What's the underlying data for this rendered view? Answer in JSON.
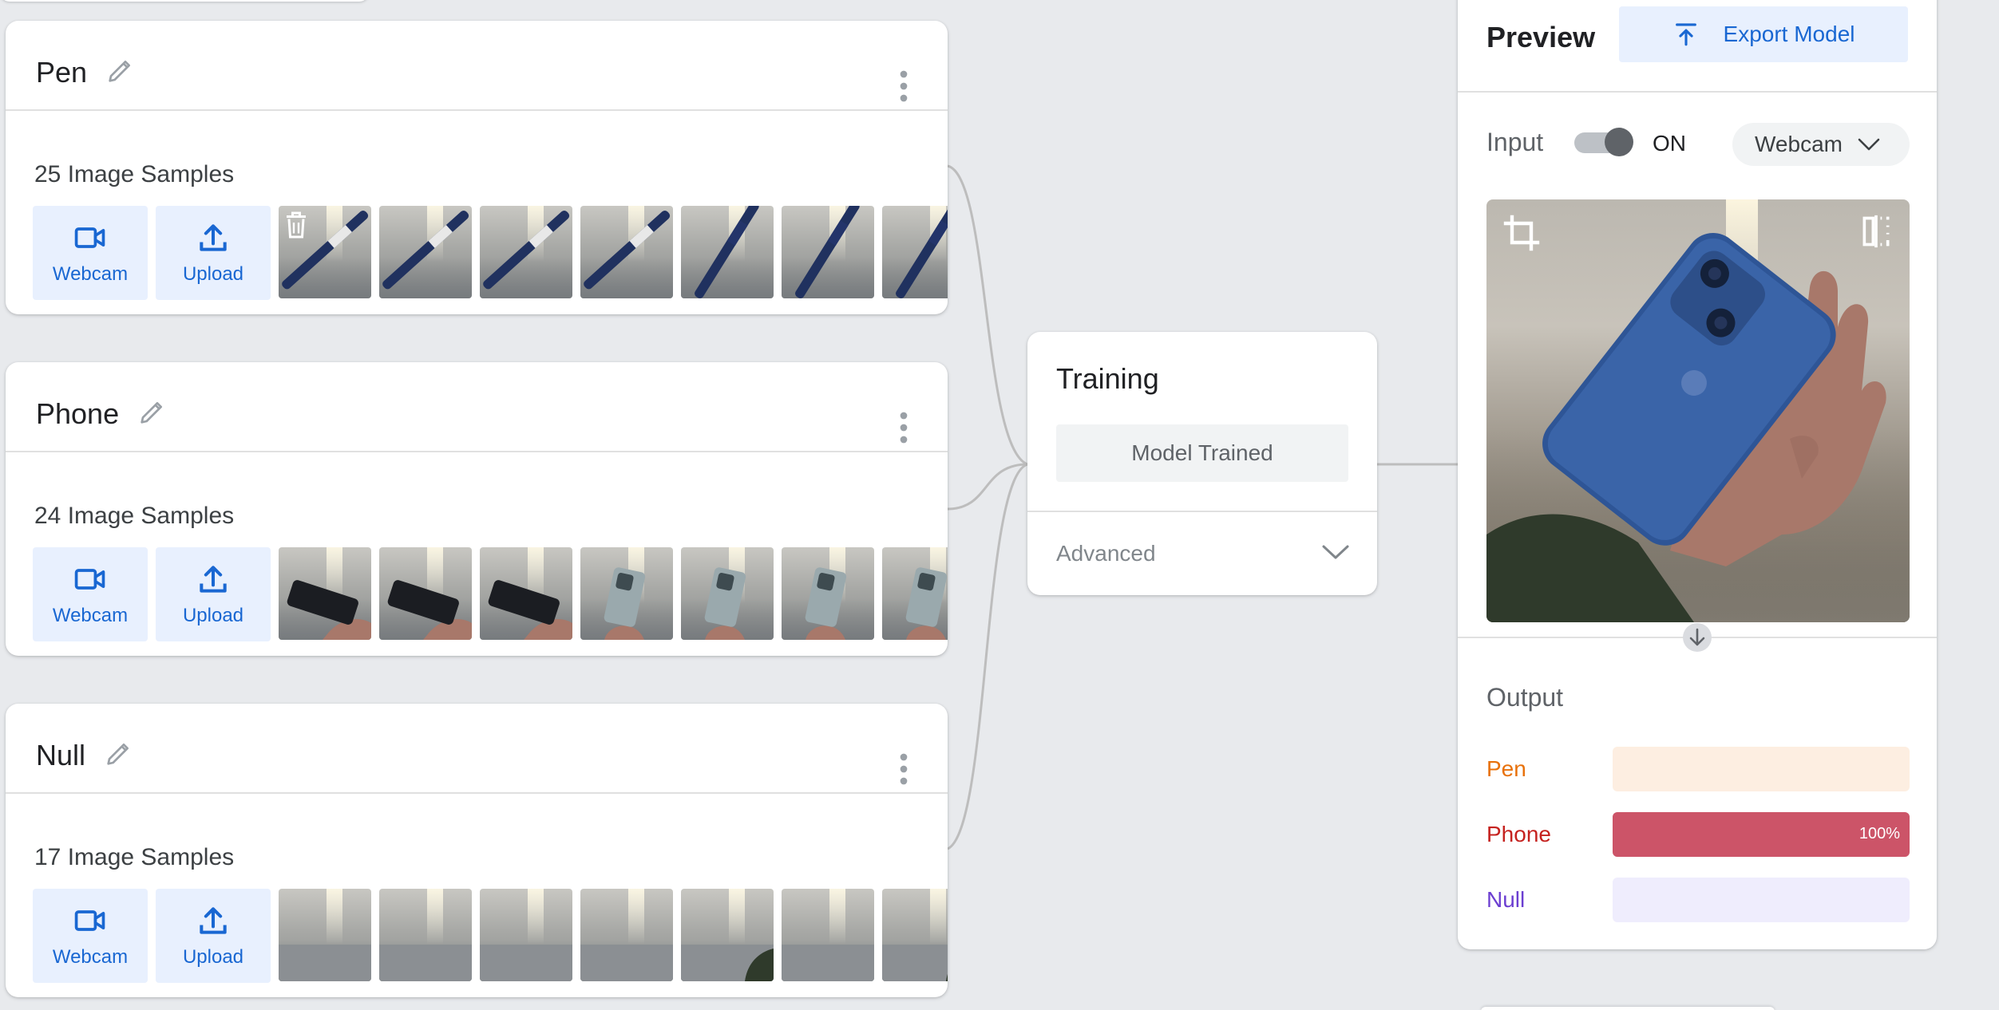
{
  "classes": [
    {
      "name": "Pen",
      "samples_label": "25 Image Samples",
      "thumb_kind": "pen"
    },
    {
      "name": "Phone",
      "samples_label": "24 Image Samples",
      "thumb_kind": "phone"
    },
    {
      "name": "Null",
      "samples_label": "17 Image Samples",
      "thumb_kind": "null"
    }
  ],
  "sample_buttons": {
    "webcam": "Webcam",
    "upload": "Upload"
  },
  "training": {
    "title": "Training",
    "status_button": "Model Trained",
    "advanced_label": "Advanced"
  },
  "preview": {
    "title": "Preview",
    "export_label": "Export Model",
    "input_label": "Input",
    "toggle_state": "ON",
    "source": "Webcam",
    "output_title": "Output",
    "outputs": [
      {
        "label": "Pen",
        "value": 0,
        "percent_label": "",
        "color": "#e8710a",
        "track": "#fdeee1"
      },
      {
        "label": "Phone",
        "value": 100,
        "percent_label": "100%",
        "color": "#c5221f",
        "fill": "#cc5468",
        "track": "#f8e0e5"
      },
      {
        "label": "Null",
        "value": 0,
        "percent_label": "",
        "color": "#6c3fd1",
        "track": "#efedfd"
      }
    ]
  },
  "icons": [
    "edit-icon",
    "more-vert-icon",
    "videocam-icon",
    "upload-icon",
    "delete-icon",
    "chevron-down-icon",
    "export-icon",
    "crop-icon",
    "flip-icon",
    "arrow-down-icon"
  ]
}
